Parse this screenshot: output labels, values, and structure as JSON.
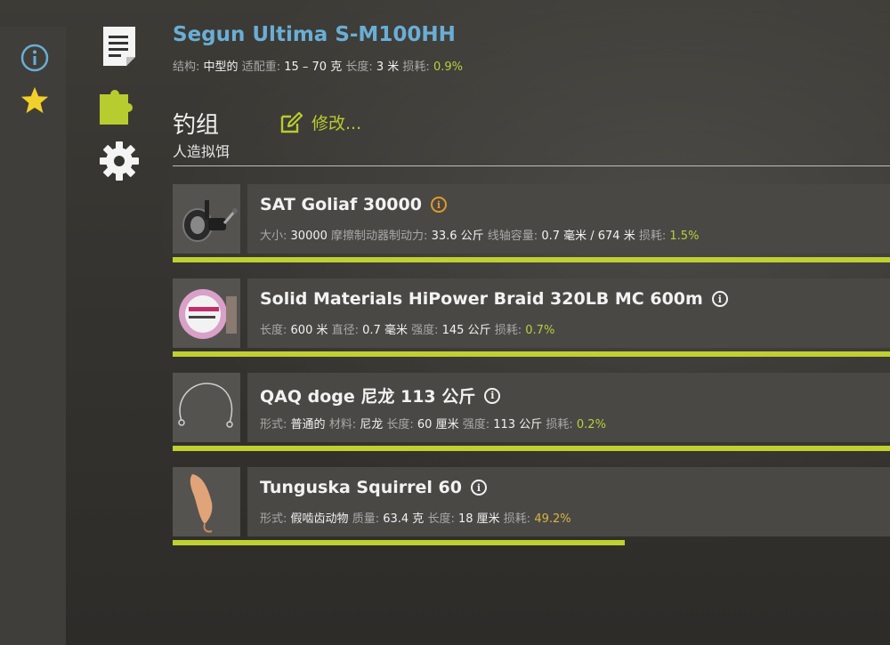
{
  "rod": {
    "name": "Segun Ultima S-M100HH",
    "stats": [
      {
        "label": "结构:",
        "value": "中型的"
      },
      {
        "label": "适配重:",
        "value": "15 – 70 克"
      },
      {
        "label": "长度:",
        "value": "3 米"
      },
      {
        "label": "损耗:",
        "value": "0.9%",
        "wear": true
      }
    ]
  },
  "rig": {
    "title": "钓组",
    "subtitle": "人造拟饵",
    "modify_label": "修改..."
  },
  "items": [
    {
      "name": "SAT Goliaf 30000",
      "info_color": "#e09a2a",
      "stats": [
        {
          "label": "大小:",
          "value": "30000"
        },
        {
          "label": "摩擦制动器制动力:",
          "value": "33.6 公斤"
        },
        {
          "label": "线轴容量:",
          "value": "0.7 毫米 / 674 米"
        },
        {
          "label": "损耗:",
          "value": "1.5%",
          "wear": true
        }
      ],
      "condition": 1.0
    },
    {
      "name": "Solid Materials HiPower Braid 320LB MC 600m",
      "stats": [
        {
          "label": "长度:",
          "value": "600 米"
        },
        {
          "label": "直径:",
          "value": "0.7 毫米"
        },
        {
          "label": "强度:",
          "value": "145 公斤"
        },
        {
          "label": "损耗:",
          "value": "0.7%",
          "wear": true
        }
      ],
      "condition": 1.0
    },
    {
      "name": "QAQ doge 尼龙 113 公斤",
      "stats": [
        {
          "label": "形式:",
          "value": "普通的"
        },
        {
          "label": "材料:",
          "value": "尼龙"
        },
        {
          "label": "长度:",
          "value": "60 厘米"
        },
        {
          "label": "强度:",
          "value": "113 公斤"
        },
        {
          "label": "损耗:",
          "value": "0.2%",
          "wear": true
        }
      ],
      "condition": 1.0
    },
    {
      "name": "Tunguska Squirrel 60",
      "stats": [
        {
          "label": "形式:",
          "value": "假啮齿动物"
        },
        {
          "label": "质量:",
          "value": "63.4 克"
        },
        {
          "label": "长度:",
          "value": "18 厘米"
        },
        {
          "label": "损耗:",
          "value": "49.2%",
          "wear": true,
          "warn": true
        }
      ],
      "condition": 0.63
    }
  ],
  "icons": {
    "rail": [
      "info-icon",
      "star-icon"
    ],
    "side": [
      "document-icon",
      "puzzle-icon",
      "gear-icon"
    ]
  },
  "colors": {
    "rod_name": "#6aaed6",
    "accent": "#bfd031",
    "star": "#f2d02a"
  }
}
